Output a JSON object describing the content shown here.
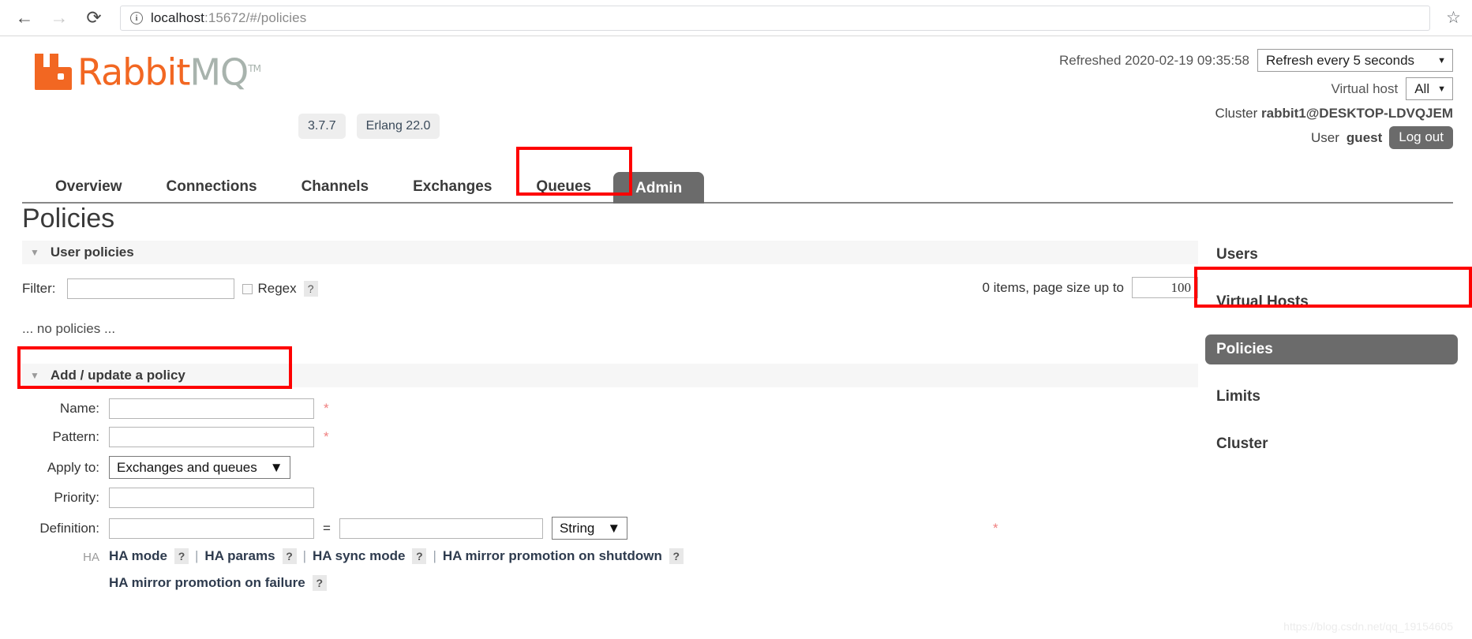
{
  "browser": {
    "back_icon": "arrow-left-icon",
    "forward_icon": "arrow-right-icon",
    "reload_icon": "reload-icon",
    "info_icon": "ⓘ",
    "url_host": "localhost",
    "url_rest": ":15672/#/policies",
    "bookmark_icon": "☆"
  },
  "header": {
    "logo_rabbit": "Rabbit",
    "logo_mq": "MQ",
    "logo_tm": "TM",
    "version_badge": "3.7.7",
    "erlang_badge": "Erlang 22.0",
    "refreshed_label": "Refreshed 2020-02-19 09:35:58",
    "refresh_select": "Refresh every 5 seconds",
    "vhost_label": "Virtual host",
    "vhost_select": "All",
    "cluster_label": "Cluster",
    "cluster_name": "rabbit1@DESKTOP-LDVQJEM",
    "user_label": "User",
    "user_name": "guest",
    "logout_label": "Log out",
    "caret": "▼"
  },
  "tabs": [
    {
      "label": "Overview",
      "active": false
    },
    {
      "label": "Connections",
      "active": false
    },
    {
      "label": "Channels",
      "active": false
    },
    {
      "label": "Exchanges",
      "active": false
    },
    {
      "label": "Queues",
      "active": false
    },
    {
      "label": "Admin",
      "active": true
    }
  ],
  "main": {
    "page_title": "Policies",
    "user_policies_section": "User policies",
    "filter_label": "Filter:",
    "filter_value": "",
    "regex_label": "Regex",
    "help_mark": "?",
    "pager_text": "0 items, page size up to",
    "page_size": "100",
    "no_policies": "... no policies ...",
    "add_section": "Add / update a policy",
    "triangle": "▼"
  },
  "form": {
    "name_label": "Name:",
    "name_value": "",
    "pattern_label": "Pattern:",
    "pattern_value": "",
    "apply_to_label": "Apply to:",
    "apply_to_value": "Exchanges and queues",
    "priority_label": "Priority:",
    "priority_value": "",
    "definition_label": "Definition:",
    "definition_key": "",
    "definition_equals": "=",
    "definition_value": "",
    "definition_type": "String",
    "required_mark": "*",
    "caret": "▼",
    "ha_tag": "HA",
    "ha_links_row1": [
      "HA mode",
      "HA params",
      "HA sync mode",
      "HA mirror promotion on shutdown"
    ],
    "ha_links_row2": [
      "HA mirror promotion on failure"
    ],
    "separator": "|"
  },
  "sidebar": {
    "items": [
      {
        "label": "Users",
        "active": false
      },
      {
        "label": "Virtual Hosts",
        "active": false
      },
      {
        "label": "Policies",
        "active": true
      },
      {
        "label": "Limits",
        "active": false
      },
      {
        "label": "Cluster",
        "active": false
      }
    ]
  },
  "watermark": "https://blog.csdn.net/qq_19154605",
  "colors": {
    "brand_orange": "#f26722",
    "brand_grey": "#a8b3ad",
    "highlight_red": "#fe0000",
    "active_grey": "#6b6b6b"
  }
}
